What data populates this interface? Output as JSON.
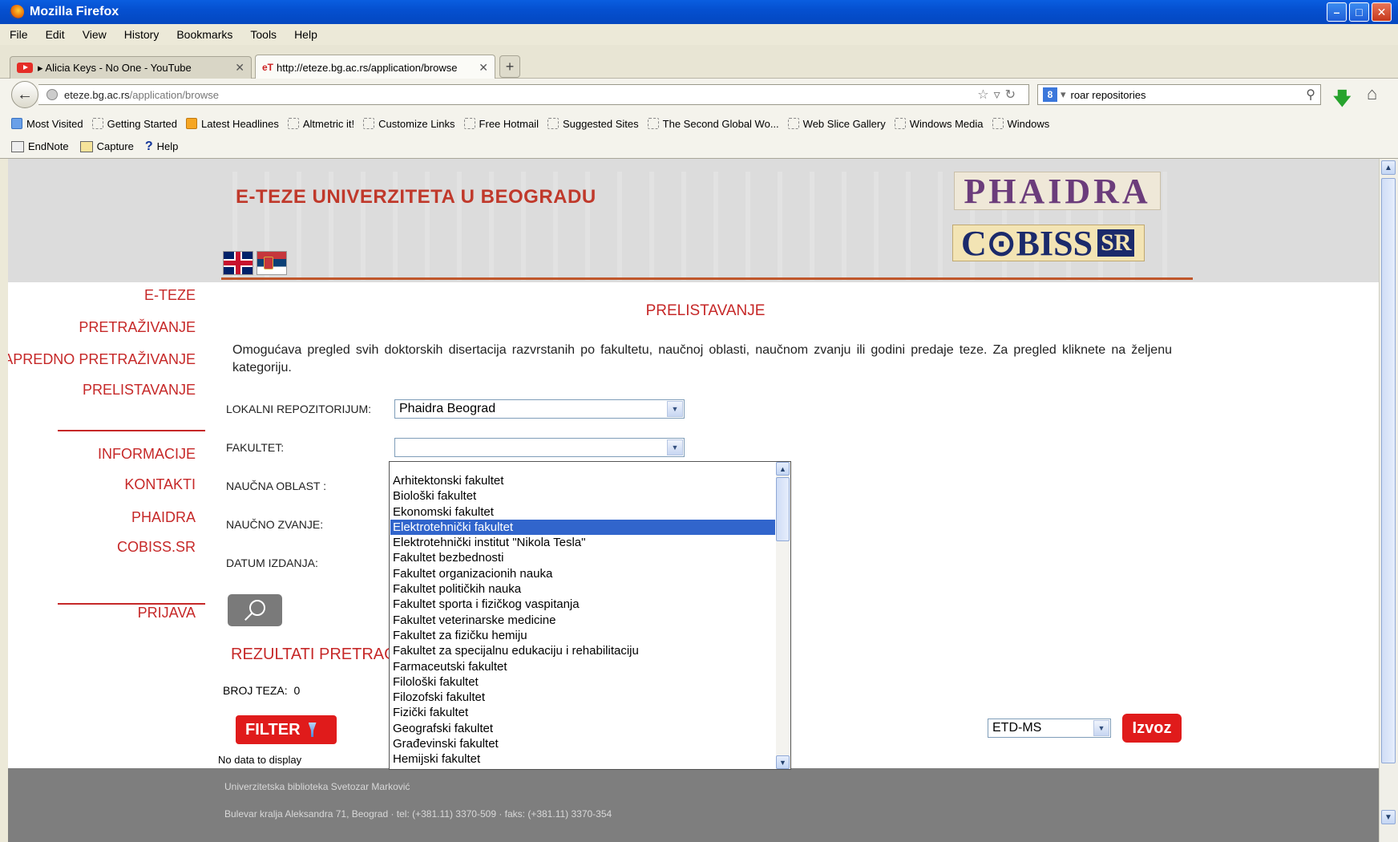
{
  "window": {
    "title": "Mozilla Firefox"
  },
  "menu": [
    "File",
    "Edit",
    "View",
    "History",
    "Bookmarks",
    "Tools",
    "Help"
  ],
  "tabs": [
    {
      "label": "▸ Alicia Keys - No One - YouTube",
      "active": false
    },
    {
      "label": "http://eteze.bg.ac.rs/application/browse",
      "active": true
    }
  ],
  "address": {
    "host": "eteze.bg.ac.rs",
    "path": "/application/browse"
  },
  "search": {
    "value": "roar repositories"
  },
  "bookmarks": [
    "Most Visited",
    "Getting Started",
    "Latest Headlines",
    "Altmetric it!",
    "Customize Links",
    "Free Hotmail",
    "Suggested Sites",
    "The Second Global Wo...",
    "Web Slice Gallery",
    "Windows Media",
    "Windows"
  ],
  "toolbar2": [
    "EndNote",
    "Capture",
    "Help"
  ],
  "site": {
    "title": "E-TEZE UNIVERZITETA U BEOGRADU",
    "logo_phaidra": "PHAIDRA",
    "logo_cobiss": "C⊙BISS",
    "logo_cobiss_sr": "SR"
  },
  "left_nav": {
    "group1": [
      "E-TEZE",
      "PRETRAŽIVANJE",
      "NAPREDNO PRETRAŽIVANJE",
      "PRELISTAVANJE"
    ],
    "group2": [
      "INFORMACIJE",
      "KONTAKTI",
      "PHAIDRA",
      "COBISS.SR"
    ],
    "group3": [
      "PRIJAVA"
    ]
  },
  "main": {
    "heading": "PRELISTAVANJE",
    "description": "Omogućava pregled svih doktorskih disertacija razvrstanih po fakultetu, naučnoj oblasti, naučnom zvanju ili godini predaje teze. Za pregled kliknete na željenu kategoriju.",
    "labels": {
      "repo": "LOKALNI REPOZITORIJUM:",
      "faculty": "FAKULTET:",
      "field": "NAUČNA OBLAST :",
      "title": "NAUČNO ZVANJE:",
      "date": "DATUM IZDANJA:"
    },
    "repo_value": "Phaidra Beograd",
    "faculty_value": "",
    "results_title": "REZULTATI PRETRAGE",
    "count_label": "BROJ TEZA:",
    "count_value": "0",
    "filter_label": "FILTER",
    "no_data": "No data to display",
    "export_format": "ETD-MS",
    "export_label": "Izvoz"
  },
  "faculty_options": [
    "Arhitektonski fakultet",
    "Biološki fakultet",
    "Ekonomski fakultet",
    "Elektrotehnički fakultet",
    "Elektrotehnički institut \"Nikola Tesla\"",
    "Fakultet bezbednosti",
    "Fakultet organizacionih nauka",
    "Fakultet političkih nauka",
    "Fakultet sporta i fizičkog vaspitanja",
    "Fakultet veterinarske medicine",
    "Fakultet za fizičku hemiju",
    "Fakultet za specijalnu edukaciju i rehabilitaciju",
    "Farmaceutski fakultet",
    "Filološki fakultet",
    "Filozofski fakultet",
    "Fizički fakultet",
    "Geografski fakultet",
    "Građevinski fakultet",
    "Hemijski fakultet"
  ],
  "faculty_selected_index": 3,
  "footer": [
    "Univerzitetska biblioteka Svetozar Marković",
    "Bulevar kralja Aleksandra 71, Beograd · tel: (+381.11) 3370-509 · faks: (+381.11) 3370-354"
  ],
  "colors": {
    "accent_red": "#c62828",
    "button_red": "#e01b1b",
    "selection_blue": "#3165cc"
  }
}
